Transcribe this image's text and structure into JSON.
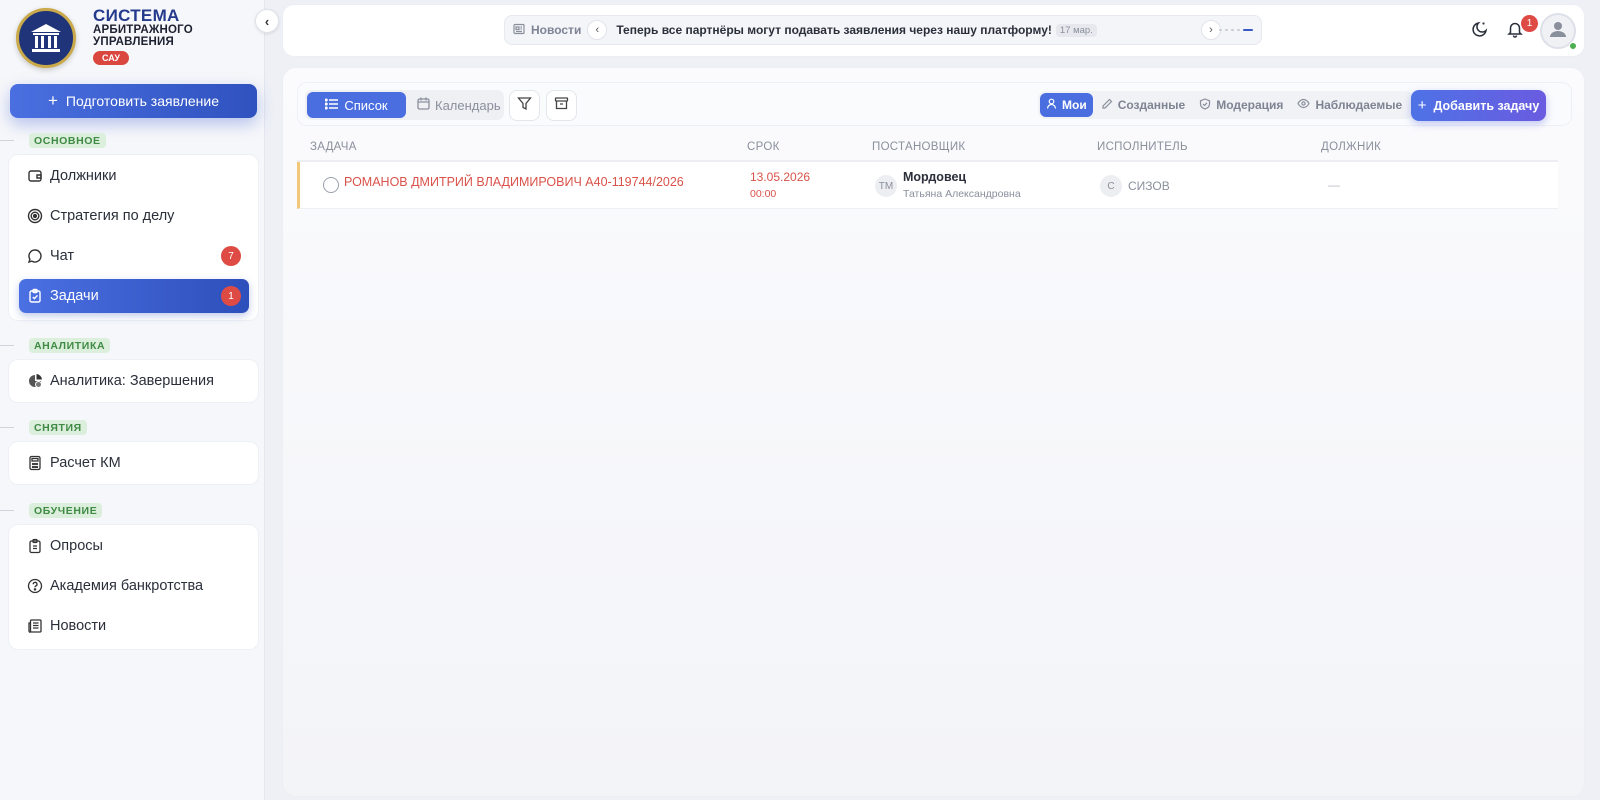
{
  "brand": {
    "title": "СИСТЕМА",
    "subtitle_line1": "АРБИТРАЖНОГО",
    "subtitle_line2": "УПРАВЛЕНИЯ",
    "badge": "САУ"
  },
  "sidebar": {
    "prepare_button": "Подготовить заявление",
    "sections": [
      {
        "label": "ОСНОВНОЕ",
        "items": [
          {
            "label": "Должники",
            "icon": "wallet-icon"
          },
          {
            "label": "Стратегия по делу",
            "icon": "target-icon"
          },
          {
            "label": "Чат",
            "icon": "chat-icon",
            "badge": "7"
          },
          {
            "label": "Задачи",
            "icon": "clipboard-check-icon",
            "badge": "1",
            "active": true
          }
        ]
      },
      {
        "label": "АНАЛИТИКА",
        "items": [
          {
            "label": "Аналитика: Завершения",
            "icon": "chart-icon"
          }
        ]
      },
      {
        "label": "СНЯТИЯ",
        "items": [
          {
            "label": "Расчет КМ",
            "icon": "calculator-icon"
          }
        ]
      },
      {
        "label": "ОБУЧЕНИЕ",
        "items": [
          {
            "label": "Опросы",
            "icon": "clipboard-list-icon"
          },
          {
            "label": "Академия банкротства",
            "icon": "help-circle-icon"
          },
          {
            "label": "Новости",
            "icon": "newspaper-icon"
          }
        ]
      }
    ]
  },
  "topbar": {
    "news_tag": "Новости",
    "news_text": "Теперь все партнёры могут подавать заявления через нашу платформу!",
    "news_date": "17 мар.",
    "bell_count": "1"
  },
  "toolbar": {
    "view_list": "Список",
    "view_calendar": "Календарь",
    "scope_mine": "Мои",
    "scope_created": "Созданные",
    "scope_moderation": "Модерация",
    "scope_watched": "Наблюдаемые",
    "add_task": "Добавить задачу"
  },
  "table": {
    "columns": [
      "ЗАДАЧА",
      "СРОК",
      "ПОСТАНОВЩИК",
      "ИСПОЛНИТЕЛЬ",
      "ДОЛЖНИК"
    ],
    "rows": [
      {
        "task": "РОМАНОВ ДМИТРИЙ ВЛАДИМИРОВИЧ А40-119744/2026",
        "due_date": "13.05.2026",
        "due_time": "00:00",
        "setter_initials": "ТМ",
        "setter_name": "Мордовец",
        "setter_sub": "Татьяна Александровна",
        "executor_initials": "С",
        "executor_name": "СИЗОВ",
        "debtor": "—"
      }
    ]
  },
  "colors": {
    "accent": "#4a6ee0",
    "danger": "#d9534a",
    "section_label_bg": "#dcefdc",
    "section_label_text": "#3f8a44"
  }
}
